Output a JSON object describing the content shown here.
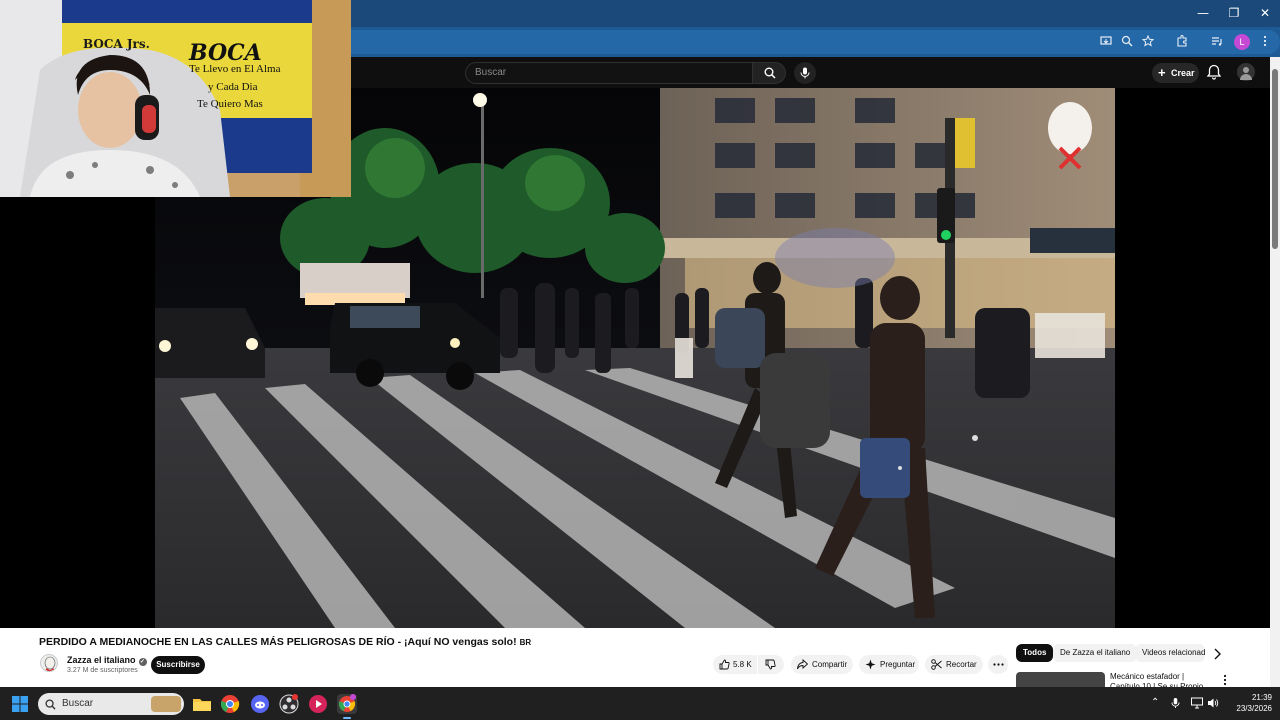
{
  "browser": {
    "minimize": "—",
    "restore": "❐",
    "close": "✕",
    "profile_letter": "L"
  },
  "header": {
    "search_placeholder": "Buscar",
    "create_label": "Crear"
  },
  "webcam": {
    "flag_line1": "BOCA Jrs.",
    "flag_title": "BOCA",
    "flag_line2": "Te Llevo en El Alma",
    "flag_line3": "y Cada Dia",
    "flag_line4": "Te Quiero Mas"
  },
  "video": {
    "title": "PERDIDO A MEDIANOCHE EN LAS CALLES MÁS PELIGROSAS DE RÍO - ¡Aquí NO vengas solo!",
    "country_badge": "BR",
    "channel_name": "Zazza el italiano",
    "subscribers": "3.27 M de suscriptores",
    "subscribe_label": "Suscribirse",
    "likes": "5.8 K",
    "share_label": "Compartir",
    "ask_label": "Preguntar",
    "clip_label": "Recortar"
  },
  "sidebar": {
    "chips": [
      "Todos",
      "De Zazza el italiano",
      "Videos relacionados"
    ],
    "rec_title": "Mecánico estafador | Capítulo 10 | Se su Propio Tramp"
  },
  "taskbar": {
    "search_placeholder": "Buscar",
    "time": "21:39",
    "date": "23/3/2026"
  },
  "colors": {
    "titlebar": "#1b4a7a",
    "toolbar": "#1e5a95",
    "yt_bg": "#0f0f0f",
    "taskbar": "#202020"
  }
}
